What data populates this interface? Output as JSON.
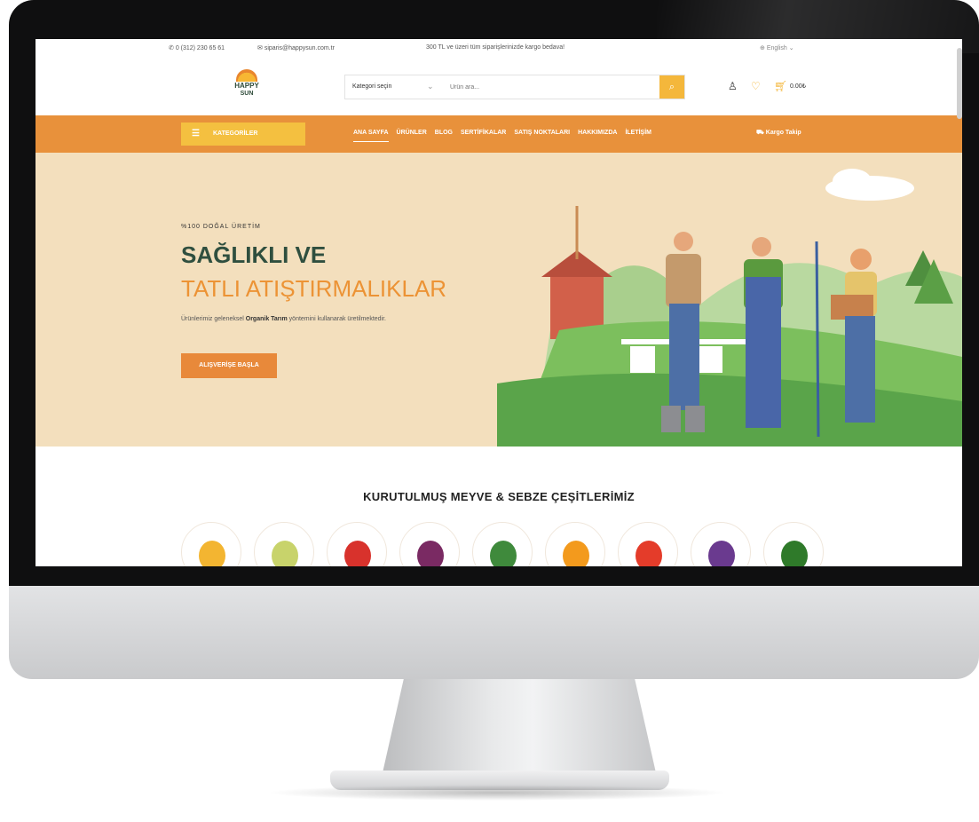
{
  "topbar": {
    "phone": "0 (312) 230 65 61",
    "email": "siparis@happysun.com.tr",
    "promo": "300 TL ve üzeri tüm siparişlerinizde kargo bedava!",
    "language": "English"
  },
  "header": {
    "logo_line1": "HAPPY",
    "logo_line2": "SUN",
    "category_select": "Kategori seçin",
    "search_placeholder": "Ürün ara...",
    "cart_total": "0.00₺"
  },
  "nav": {
    "categories_button": "KATEGORİLER",
    "items": [
      "ANA SAYFA",
      "ÜRÜNLER",
      "BLOG",
      "SERTİFİKALAR",
      "SATIŞ NOKTALARI",
      "HAKKIMIZDA",
      "İLETİŞİM"
    ],
    "track": "Kargo Takip"
  },
  "hero": {
    "kicker": "%100 DOĞAL ÜRETİM",
    "title_line1": "SAĞLIKLI VE",
    "title_line2": "TATLI ATIŞTIRMALIKLAR",
    "desc_pre": "Ürünlerimiz geleneksel",
    "desc_bold": "Organik Tarım",
    "desc_post": "yöntemini kullanarak üretilmektedir.",
    "cta": "ALIŞVERİŞE BAŞLA"
  },
  "categories": {
    "title": "KURUTULMUŞ MEYVE & SEBZE ÇEŞİTLERİMİZ",
    "items": [
      {
        "icon": "pineapple-icon",
        "color": "#f3b531"
      },
      {
        "icon": "pear-icon",
        "color": "#c8d36b"
      },
      {
        "icon": "apple-icon",
        "color": "#d8322c"
      },
      {
        "icon": "plum-icon",
        "color": "#7a2a63"
      },
      {
        "icon": "watermelon-icon",
        "color": "#3f8a3c"
      },
      {
        "icon": "orange-icon",
        "color": "#f39a1d"
      },
      {
        "icon": "tomato-icon",
        "color": "#e43c2a"
      },
      {
        "icon": "eggplant-icon",
        "color": "#6a3a8f"
      },
      {
        "icon": "pepper-icon",
        "color": "#2f7a2a"
      }
    ]
  },
  "colors": {
    "accent_orange": "#e8913b",
    "accent_yellow": "#f4b73b",
    "dark_green": "#2f4f3f"
  }
}
